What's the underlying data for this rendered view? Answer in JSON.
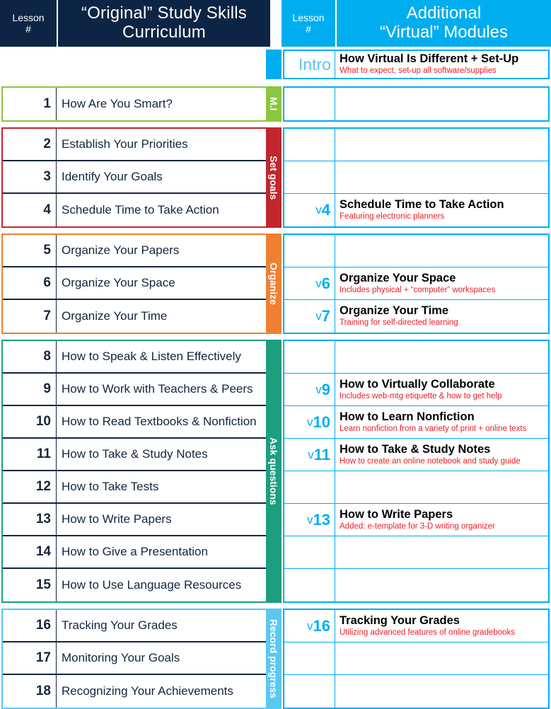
{
  "header": {
    "left_lesson_label": "Lesson\n#",
    "left_title": "“Original” Study Skills Curriculum",
    "left_title_line1": "“Original” Study Skills",
    "left_title_line2": "Curriculum",
    "right_lesson_label": "Lesson\n#",
    "right_title_line1": "Additional",
    "right_title_line2": "“Virtual” Modules",
    "left_bg": "#0d2544",
    "right_bg": "#00aeef"
  },
  "intro": {
    "number": "Intro",
    "title": "How Virtual Is Different + Set-Up",
    "subtitle": "What to expect, set-up all software/supplies",
    "band_color": "#00aeef"
  },
  "groups": [
    {
      "band_label": "M.I",
      "band_color": "#8cc63f",
      "border_color": "#8cc63f",
      "right_border_color": "#00aeef",
      "lessons": [
        {
          "num": "1",
          "title": "How Are You Smart?"
        }
      ],
      "virtual": [
        {
          "num": "",
          "prefix": "",
          "title": "",
          "subtitle": ""
        }
      ]
    },
    {
      "band_label": "Set goals",
      "band_color": "#c1272d",
      "border_color": "#c1272d",
      "right_border_color": "#00aeef",
      "lessons": [
        {
          "num": "2",
          "title": "Establish Your Priorities"
        },
        {
          "num": "3",
          "title": "Identify Your Goals"
        },
        {
          "num": "4",
          "title": "Schedule Time to Take Action"
        }
      ],
      "virtual": [
        {
          "num": "",
          "prefix": "",
          "title": "",
          "subtitle": ""
        },
        {
          "num": "",
          "prefix": "",
          "title": "",
          "subtitle": ""
        },
        {
          "num": "4",
          "prefix": "v",
          "title": "Schedule Time to Take Action",
          "subtitle": "Featuring electronic planners"
        }
      ]
    },
    {
      "band_label": "Organize",
      "band_color": "#ef8033",
      "border_color": "#ef8033",
      "right_border_color": "#00aeef",
      "lessons": [
        {
          "num": "5",
          "title": "Organize Your Papers"
        },
        {
          "num": "6",
          "title": "Organize Your Space"
        },
        {
          "num": "7",
          "title": "Organize Your Time"
        }
      ],
      "virtual": [
        {
          "num": "",
          "prefix": "",
          "title": "",
          "subtitle": ""
        },
        {
          "num": "6",
          "prefix": "v",
          "title": "Organize Your Space",
          "subtitle": "Includes physical + “computer” workspaces"
        },
        {
          "num": "7",
          "prefix": "v",
          "title": "Organize Your Time",
          "subtitle": "Training for self-directed learning"
        }
      ]
    },
    {
      "band_label": "Ask questions",
      "band_color": "#1d9e7f",
      "border_color": "#1d9e7f",
      "right_border_color": "#00aeef",
      "lessons": [
        {
          "num": "8",
          "title": "How to Speak & Listen Effectively"
        },
        {
          "num": "9",
          "title": "How to Work with Teachers & Peers"
        },
        {
          "num": "10",
          "title": "How to Read Textbooks & Nonfiction"
        },
        {
          "num": "11",
          "title": "How to Take & Study Notes"
        },
        {
          "num": "12",
          "title": "How to Take Tests"
        },
        {
          "num": "13",
          "title": "How to Write Papers"
        },
        {
          "num": "14",
          "title": "How to Give a Presentation"
        },
        {
          "num": "15",
          "title": "How to Use Language Resources"
        }
      ],
      "virtual": [
        {
          "num": "",
          "prefix": "",
          "title": "",
          "subtitle": ""
        },
        {
          "num": "9",
          "prefix": "v",
          "title": "How to Virtually Collaborate",
          "subtitle": "Includes web-mtg etiquette & how to get help"
        },
        {
          "num": "10",
          "prefix": "v",
          "title": "How to Learn Nonfiction",
          "subtitle": "Learn nonfiction from a variety of print + online texts"
        },
        {
          "num": "11",
          "prefix": "v",
          "title": "How to Take & Study Notes",
          "subtitle": "How to create an online notebook and study guide"
        },
        {
          "num": "",
          "prefix": "",
          "title": "",
          "subtitle": ""
        },
        {
          "num": "13",
          "prefix": "v",
          "title": "How to Write Papers",
          "subtitle": "Added: e-template for 3-D writing organizer"
        },
        {
          "num": "",
          "prefix": "",
          "title": "",
          "subtitle": ""
        },
        {
          "num": "",
          "prefix": "",
          "title": "",
          "subtitle": ""
        }
      ]
    },
    {
      "band_label": "Record progress",
      "band_color": "#5bc8f2",
      "border_color": "#5bc8f2",
      "right_border_color": "#00aeef",
      "lessons": [
        {
          "num": "16",
          "title": "Tracking Your Grades"
        },
        {
          "num": "17",
          "title": "Monitoring Your Goals"
        },
        {
          "num": "18",
          "title": "Recognizing Your Achievements"
        }
      ],
      "virtual": [
        {
          "num": "16",
          "prefix": "v",
          "title": "Tracking Your Grades",
          "subtitle": "Utilizing advanced features of online gradebooks"
        },
        {
          "num": "",
          "prefix": "",
          "title": "",
          "subtitle": ""
        },
        {
          "num": "",
          "prefix": "",
          "title": "",
          "subtitle": ""
        }
      ]
    }
  ],
  "colors": {
    "navy": "#14253f",
    "cyan": "#00aeef",
    "red_text": "#ed1c24"
  }
}
